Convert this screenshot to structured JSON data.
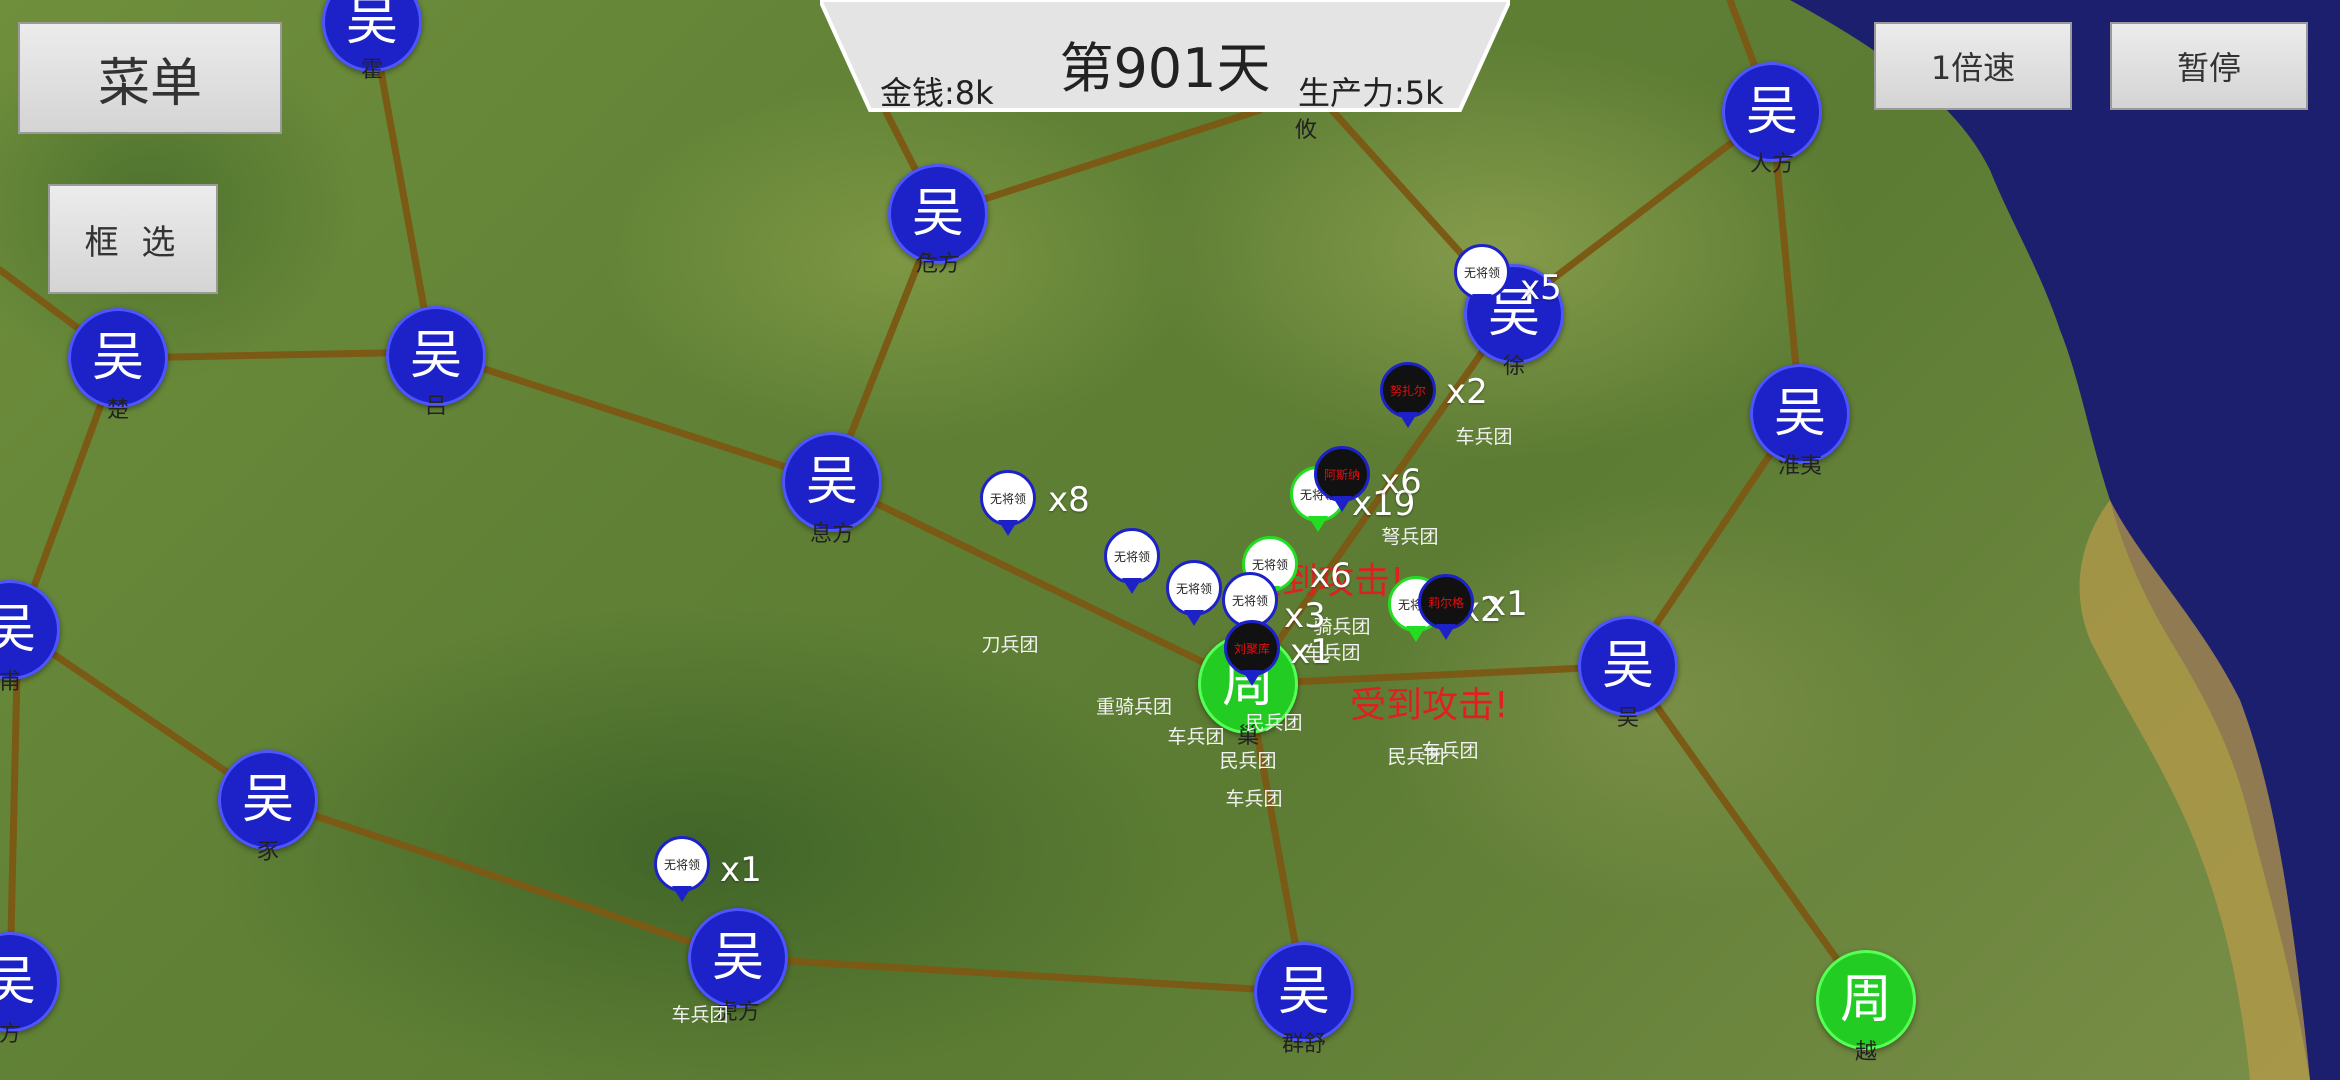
{
  "hud": {
    "menu_label": "菜单",
    "select_label": "框 选",
    "speed_label": "1倍速",
    "pause_label": "暂停",
    "day_label": "第901天",
    "money_label": "金钱:8k",
    "production_label": "生产力:5k"
  },
  "colors": {
    "wu_city": "#1d22c8",
    "zhou_city": "#22cc22",
    "road": "#7a5a14",
    "alert": "#e02020",
    "sea": "#1c1f6e"
  },
  "cities": [
    {
      "id": "huo",
      "glyph": "吴",
      "label": "霍",
      "faction": "wu"
    },
    {
      "id": "weifang",
      "glyph": "吴",
      "label": "危方",
      "faction": "wu"
    },
    {
      "id": "you",
      "glyph": "吴",
      "label": "攸",
      "faction": "wu"
    },
    {
      "id": "renfang",
      "glyph": "吴",
      "label": "人方",
      "faction": "wu"
    },
    {
      "id": "chu",
      "glyph": "吴",
      "label": "楚",
      "faction": "wu"
    },
    {
      "id": "lv",
      "glyph": "吴",
      "label": "吕",
      "faction": "wu"
    },
    {
      "id": "xifang",
      "glyph": "吴",
      "label": "息方",
      "faction": "wu"
    },
    {
      "id": "xu",
      "glyph": "吴",
      "label": "徐",
      "faction": "wu"
    },
    {
      "id": "huaiyi",
      "glyph": "吴",
      "label": "淮夷",
      "faction": "wu"
    },
    {
      "id": "west1",
      "glyph": "吴",
      "label": "甫",
      "faction": "wu"
    },
    {
      "id": "wu",
      "glyph": "吴",
      "label": "吴",
      "faction": "wu"
    },
    {
      "id": "zhou-capital",
      "glyph": "周",
      "label": "巢",
      "faction": "zhou"
    },
    {
      "id": "shi",
      "glyph": "吴",
      "label": "豕",
      "faction": "wu"
    },
    {
      "id": "hufang",
      "glyph": "吴",
      "label": "虎方",
      "faction": "wu"
    },
    {
      "id": "qunshu",
      "glyph": "吴",
      "label": "群舒",
      "faction": "wu"
    },
    {
      "id": "yue",
      "glyph": "周",
      "label": "越",
      "faction": "zhou"
    },
    {
      "id": "west2",
      "glyph": "吴",
      "label": "方",
      "faction": "wu"
    }
  ],
  "units": [
    {
      "id": "u1",
      "name": "无将领",
      "faction": "neutral",
      "count": "x5"
    },
    {
      "id": "u2",
      "name": "努扎尔",
      "faction": "enemy",
      "count": "x2"
    },
    {
      "id": "u3",
      "name": "阿斯纳",
      "faction": "enemy",
      "count": "x6"
    },
    {
      "id": "u4",
      "name": "无将领",
      "faction": "ally",
      "count": "x19"
    },
    {
      "id": "u5",
      "name": "无将领",
      "faction": "neutral",
      "count": "x8"
    },
    {
      "id": "u6",
      "name": "无将领",
      "faction": "neutral",
      "count": ""
    },
    {
      "id": "u7",
      "name": "无将领",
      "faction": "neutral",
      "count": ""
    },
    {
      "id": "u8",
      "name": "无将领",
      "faction": "ally",
      "count": "x6"
    },
    {
      "id": "u9",
      "name": "无将领",
      "faction": "neutral",
      "count": "x3"
    },
    {
      "id": "u10",
      "name": "刘聚库",
      "faction": "enemy",
      "count": "x1"
    },
    {
      "id": "u11",
      "name": "无将领",
      "faction": "ally",
      "count": "x2"
    },
    {
      "id": "u12",
      "name": "莉尔格",
      "faction": "enemy",
      "count": "x1"
    },
    {
      "id": "u13",
      "name": "无将领",
      "faction": "neutral",
      "count": "x1"
    }
  ],
  "troops": [
    "车兵团",
    "弩兵团",
    "刀兵团",
    "重骑兵团",
    "车兵团",
    "民兵团",
    "民兵团",
    "车兵团",
    "骑兵团",
    "车兵团",
    "民兵团",
    "车兵团",
    "车兵团"
  ],
  "alerts": [
    "受到攻击!",
    "受到攻击!"
  ]
}
